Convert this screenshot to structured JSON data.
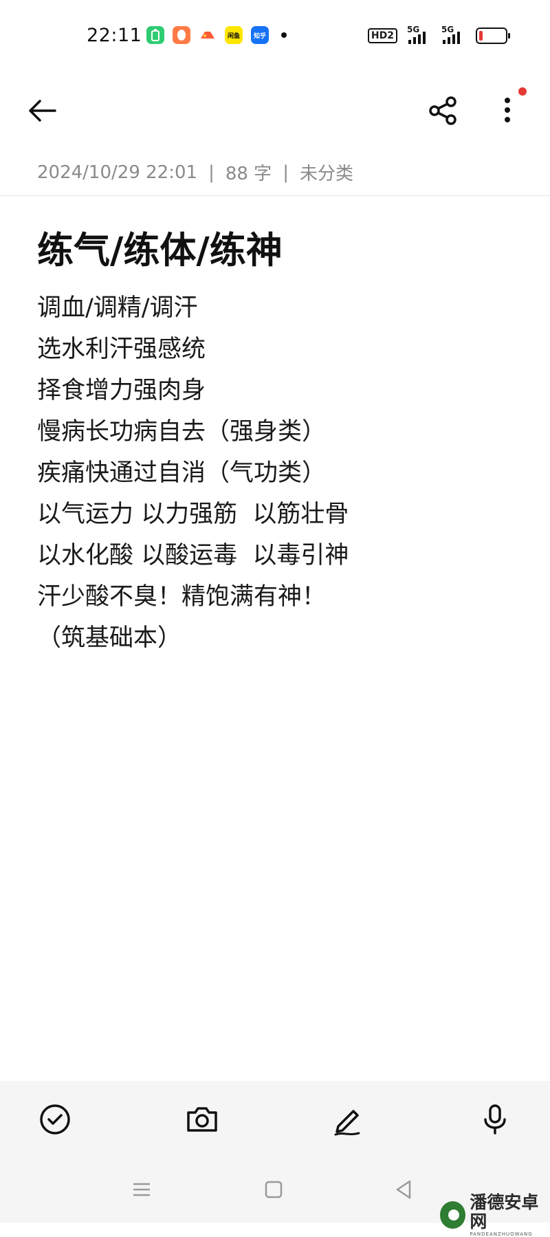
{
  "status_bar": {
    "time": "22:11",
    "apps": [
      {
        "icon": "battery-manager-app-icon",
        "color": "#2ecc71",
        "label": ""
      },
      {
        "icon": "browser-app-icon",
        "color": "#ff7a45",
        "label": ""
      },
      {
        "icon": "game-app-icon",
        "color": "#ffffff",
        "label": ""
      },
      {
        "icon": "xianyu-app-icon",
        "color": "#ffe600",
        "label": "闲鱼"
      },
      {
        "icon": "zhihu-app-icon",
        "color": "#1772f6",
        "label": "知乎"
      }
    ],
    "hd_label": "HD2",
    "signal_1": "5G",
    "signal_2": "5G",
    "battery_color": "#e53935"
  },
  "note": {
    "meta": {
      "date": "2024/10/29 22:01",
      "count": "88 字",
      "category": "未分类"
    },
    "title": "练气/练体/练神",
    "lines": [
      "调血/调精/调汗",
      "选水利汗强感统",
      "择食增力强肉身",
      "慢病长功病自去（强身类）",
      "疾痛快通过自消（气功类）",
      "以气运力 以力强筋  以筋壮骨",
      "以水化酸 以酸运毒  以毒引神",
      "汗少酸不臭！精饱满有神！",
      "（筑基础本）"
    ]
  },
  "watermark": {
    "title": "潘德安卓网",
    "subtitle": "PANDEANZHUOWANG"
  },
  "accent_color": "#e53935"
}
